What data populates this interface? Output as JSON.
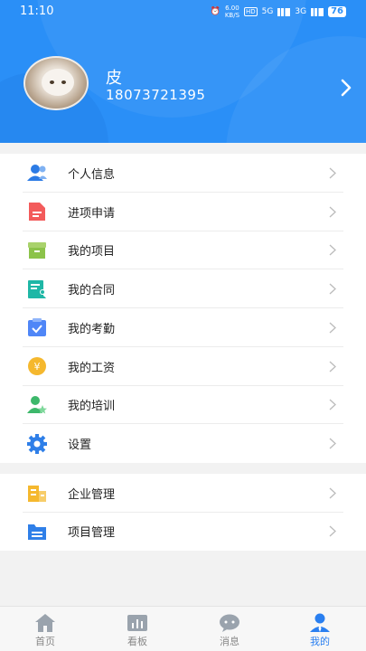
{
  "status_bar": {
    "time": "11:10",
    "net_speed": "6.00",
    "net_unit": "KB/S",
    "hd_label": "HD",
    "signal1": "5G",
    "signal2": "3G",
    "battery": "76"
  },
  "profile": {
    "name": "皮",
    "phone": "18073721395"
  },
  "menu_group1": [
    {
      "label": "个人信息",
      "icon": "person-card-icon",
      "color": "#2c7be5"
    },
    {
      "label": "进项申请",
      "icon": "document-icon",
      "color": "#f35b5b"
    },
    {
      "label": "我的项目",
      "icon": "box-icon",
      "color": "#8cc34a"
    },
    {
      "label": "我的合同",
      "icon": "contract-icon",
      "color": "#1fb7a6"
    },
    {
      "label": "我的考勤",
      "icon": "clipboard-check-icon",
      "color": "#4f86f7"
    },
    {
      "label": "我的工资",
      "icon": "yen-coin-icon",
      "color": "#f5b82e"
    },
    {
      "label": "我的培训",
      "icon": "person-star-icon",
      "color": "#3db86b"
    },
    {
      "label": "设置",
      "icon": "gear-icon",
      "color": "#2f7fe8"
    }
  ],
  "menu_group2": [
    {
      "label": "企业管理",
      "icon": "building-icon",
      "color": "#f5b82e"
    },
    {
      "label": "项目管理",
      "icon": "folder-icon",
      "color": "#2f7fe8"
    }
  ],
  "tabs": [
    {
      "label": "首页",
      "icon": "home-icon",
      "active": false
    },
    {
      "label": "看板",
      "icon": "dashboard-icon",
      "active": false
    },
    {
      "label": "消息",
      "icon": "chat-icon",
      "active": false
    },
    {
      "label": "我的",
      "icon": "user-icon",
      "active": true
    }
  ],
  "colors": {
    "header": "#2a8ff7",
    "active_tab": "#2a7ff0",
    "inactive_tab": "#888888"
  }
}
